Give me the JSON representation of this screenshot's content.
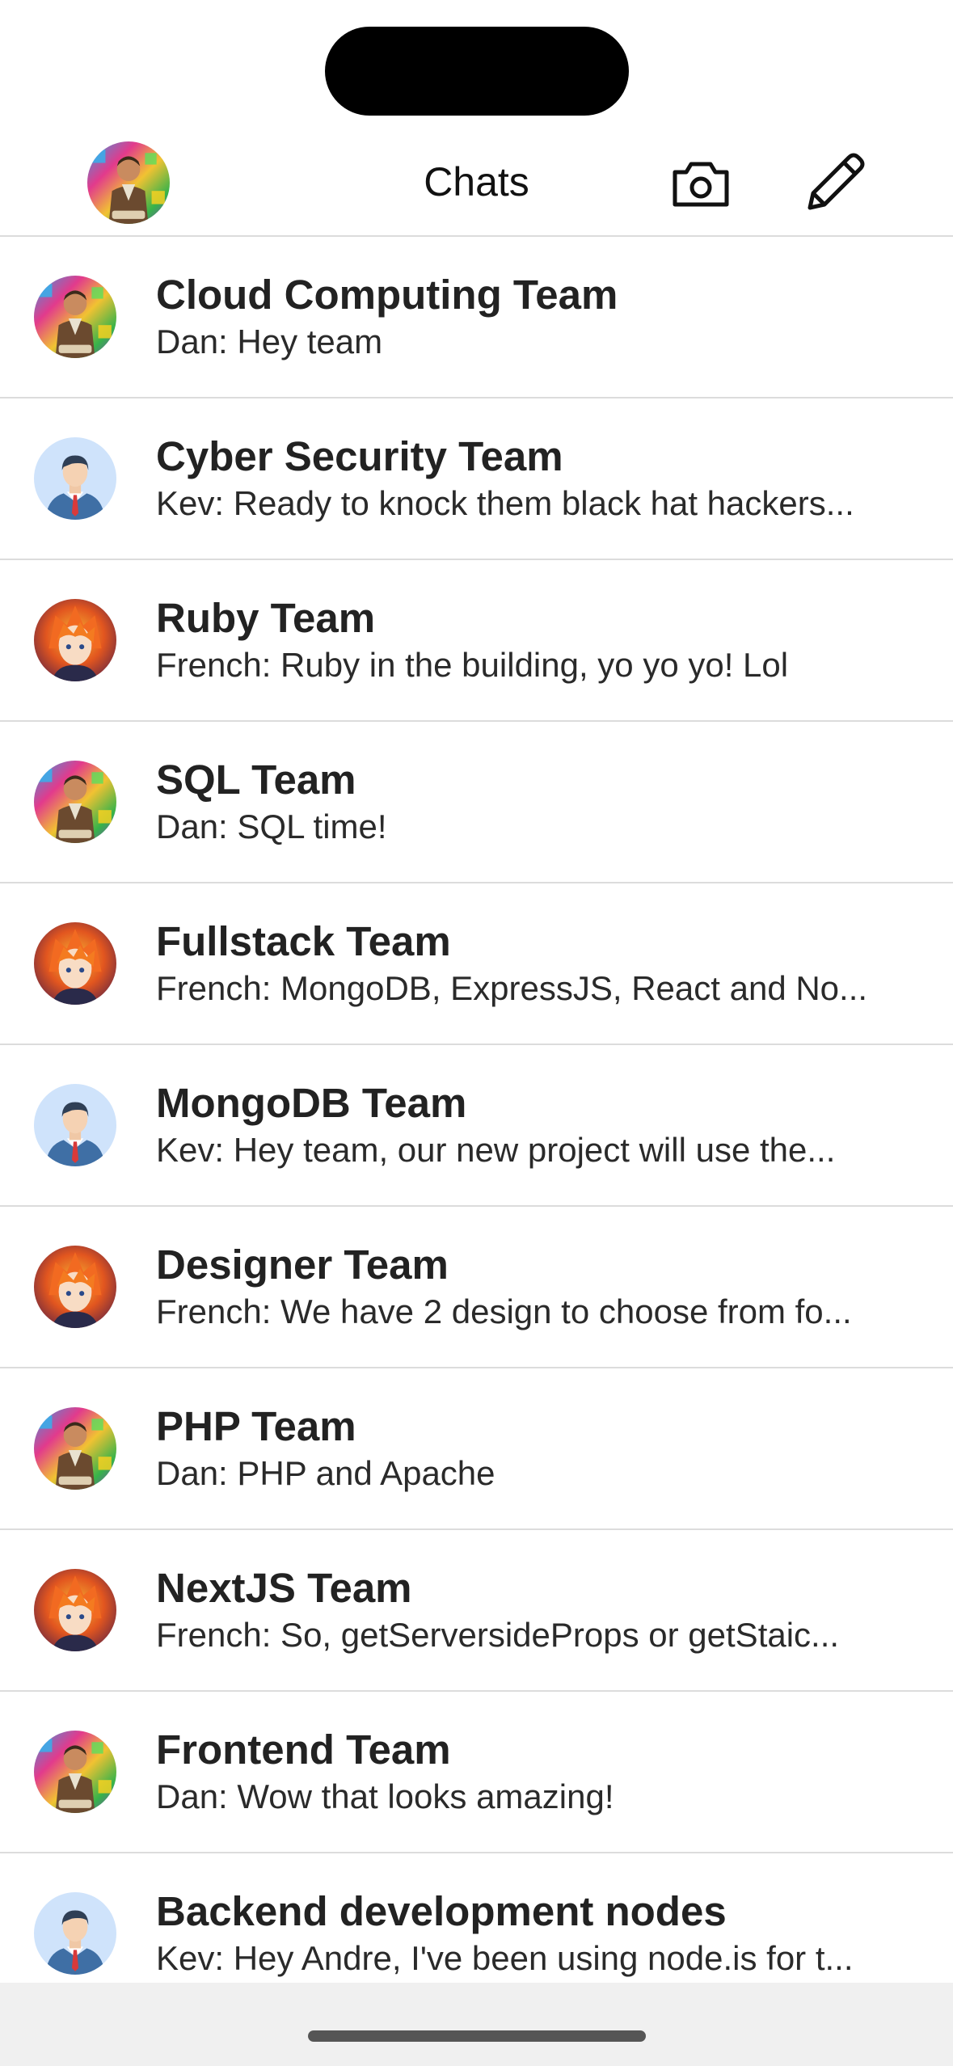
{
  "header": {
    "title": "Chats",
    "avatar_icon": "user-avatar-dan",
    "camera_icon": "camera-icon",
    "compose_icon": "compose-pencil-icon"
  },
  "chats": [
    {
      "name": "Cloud Computing Team",
      "preview": "Dan: Hey team",
      "avatar": "dan"
    },
    {
      "name": "Cyber Security Team",
      "preview": "Kev: Ready to knock them black hat hackers...",
      "avatar": "kev"
    },
    {
      "name": "Ruby Team",
      "preview": "French: Ruby in the building, yo yo yo! Lol",
      "avatar": "french"
    },
    {
      "name": "SQL Team",
      "preview": "Dan: SQL time!",
      "avatar": "dan"
    },
    {
      "name": "Fullstack Team",
      "preview": "French: MongoDB, ExpressJS, React and No...",
      "avatar": "french"
    },
    {
      "name": "MongoDB Team",
      "preview": "Kev: Hey team, our new project will use the...",
      "avatar": "kev"
    },
    {
      "name": "Designer Team",
      "preview": "French: We have 2 design to choose from fo...",
      "avatar": "french"
    },
    {
      "name": "PHP Team",
      "preview": "Dan: PHP and Apache",
      "avatar": "dan"
    },
    {
      "name": "NextJS Team",
      "preview": "French: So, getServersideProps or getStaic...",
      "avatar": "french"
    },
    {
      "name": "Frontend Team",
      "preview": "Dan: Wow that looks amazing!",
      "avatar": "dan"
    },
    {
      "name": "Backend development nodes",
      "preview": "Kev: Hey Andre, I've been using node.is for t...",
      "avatar": "kev"
    }
  ],
  "colors": {
    "divider": "#dcdcdc",
    "text": "#222222",
    "bottom_bar": "#f0f0f0"
  }
}
